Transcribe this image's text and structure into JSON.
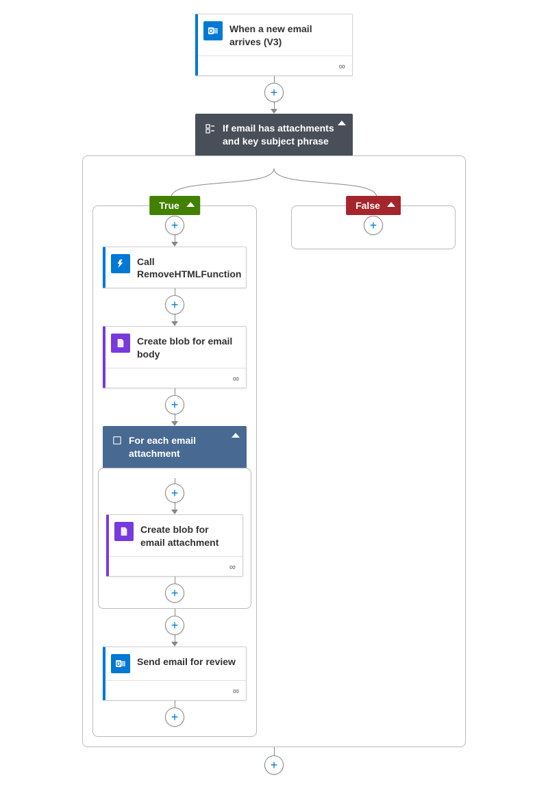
{
  "trigger": {
    "title": "When a new email arrives (V3)"
  },
  "condition": {
    "title": "If email has attachments and key subject phrase"
  },
  "branches": {
    "true_label": "True",
    "false_label": "False"
  },
  "true_actions": {
    "call_fn": {
      "title": "Call RemoveHTMLFunction"
    },
    "blob_body": {
      "title": "Create blob for email body"
    },
    "foreach": {
      "title": "For each email attachment"
    },
    "blob_attach": {
      "title": "Create blob for email attachment"
    },
    "send_email": {
      "title": "Send email for review"
    }
  }
}
